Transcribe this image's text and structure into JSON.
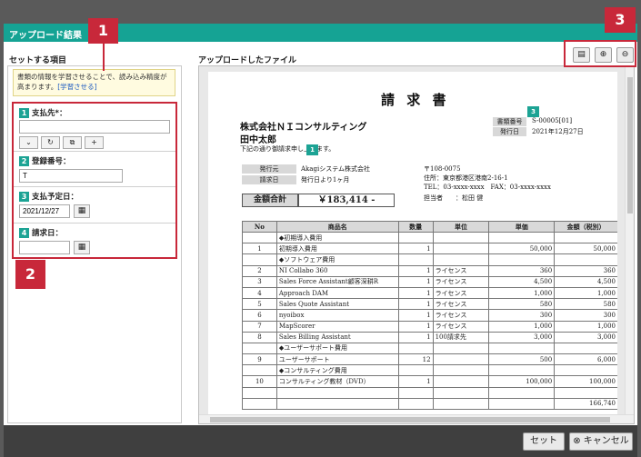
{
  "window": {
    "title": "アップロード結果"
  },
  "left_panel": {
    "title": "セットする項目",
    "hint_text": "書類の情報を学習させることで、読み込み精度が高まります。",
    "hint_link": "[学習させる]",
    "fields": [
      {
        "num": "1",
        "label": "支払先*：",
        "value": ""
      },
      {
        "num": "2",
        "label": "登録番号：",
        "value": "T"
      },
      {
        "num": "3",
        "label": "支払予定日：",
        "value": "2021/12/27"
      },
      {
        "num": "4",
        "label": "請求日：",
        "value": ""
      }
    ]
  },
  "right_panel": {
    "title": "アップロードしたファイル"
  },
  "callouts": {
    "c1": "1",
    "c2": "2",
    "c3": "3"
  },
  "document": {
    "title": "請 求 書",
    "company": "株式会社ＮＩコンサルティング",
    "person": "田中太郎",
    "notice": "下記の通り御請求申し上げます。",
    "marker": "1",
    "doc_no_label": "書類番号",
    "doc_no": "S-00005[01]",
    "issue_label": "発行日",
    "issue_date": "2021年12月27日",
    "badge3": "3",
    "issuer_label": "発行元",
    "issuer": "Akagiシステム株式会社",
    "req_label": "請求日",
    "req_value": "発行日より1ヶ月",
    "postal": "〒108-0075",
    "address": "住所：東京都港区港南2-16-1",
    "tel": "TEL：03-xxxx-xxxx　FAX：03-xxxx-xxxx",
    "contact": "担当者　　：松田 健",
    "total_label": "金額合計",
    "total_value": "￥183,414 -",
    "headers": [
      "No",
      "商品名",
      "数量",
      "単位",
      "単価",
      "金額（税別）"
    ],
    "rows": [
      [
        "",
        "◆初期導入費用",
        "",
        "",
        "",
        ""
      ],
      [
        "1",
        "初期導入費用",
        "1",
        "",
        "50,000",
        "50,000"
      ],
      [
        "",
        "◆ソフトウェア費用",
        "",
        "",
        "",
        ""
      ],
      [
        "2",
        "NI Collabo 360",
        "1",
        "ライセンス",
        "360",
        "360"
      ],
      [
        "3",
        "Sales Force Assistant顧客深耕R",
        "1",
        "ライセンス",
        "4,500",
        "4,500"
      ],
      [
        "4",
        "Approach DAM",
        "1",
        "ライセンス",
        "1,000",
        "1,000"
      ],
      [
        "5",
        "Sales Quote Assistant",
        "1",
        "ライセンス",
        "580",
        "580"
      ],
      [
        "6",
        "nyoibox",
        "1",
        "ライセンス",
        "300",
        "300"
      ],
      [
        "7",
        "MapScorer",
        "1",
        "ライセンス",
        "1,000",
        "1,000"
      ],
      [
        "8",
        "Sales Billing Assistant",
        "1",
        "100請求先",
        "3,000",
        "3,000"
      ],
      [
        "",
        "◆ユーザーサポート費用",
        "",
        "",
        "",
        ""
      ],
      [
        "9",
        "ユーザーサポート",
        "12",
        "",
        "500",
        "6,000"
      ],
      [
        "",
        "◆コンサルティング費用",
        "",
        "",
        "",
        ""
      ],
      [
        "10",
        "コンサルティング教材（DVD）",
        "1",
        "",
        "100,000",
        "100,000"
      ],
      [
        "",
        "",
        "",
        "",
        "",
        ""
      ],
      [
        "",
        "",
        "",
        "",
        "",
        "166,740"
      ]
    ]
  },
  "footer": {
    "set_label": "セット",
    "cancel_label": "キャンセル"
  }
}
